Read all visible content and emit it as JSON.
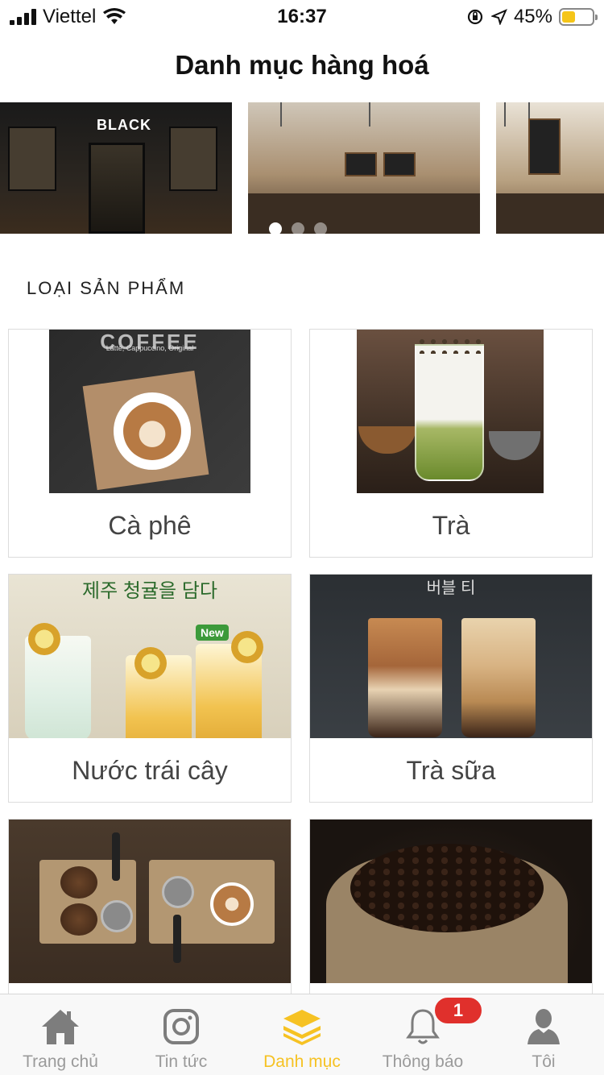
{
  "status_bar": {
    "carrier": "Viettel",
    "time": "16:37",
    "battery": "45%",
    "battery_level": 0.45
  },
  "header": {
    "title": "Danh mục hàng hoá"
  },
  "carousel": {
    "active_index": 0,
    "dot_count": 3,
    "slides": [
      {
        "icon": "black-coffee-shop-image",
        "sign": "BLACK"
      },
      {
        "icon": "coffee-counter-image"
      },
      {
        "icon": "coffee-bar-image"
      }
    ]
  },
  "section": {
    "title": "LOẠI SẢN PHẨM"
  },
  "categories": [
    {
      "label": "Cà phê",
      "icon": "coffee-poster-image",
      "poster_title": "COFFEE",
      "poster_sub": "Latte, Cappuccino, Original"
    },
    {
      "label": "Trà",
      "icon": "matcha-tea-image"
    },
    {
      "label": "Nước trái cây",
      "icon": "juice-image",
      "banner": "제주 청귤을 담다",
      "badge": "New"
    },
    {
      "label": "Trà sữa",
      "icon": "bubble-milk-tea-image",
      "banner": "버블 티"
    },
    {
      "label": "",
      "icon": "coffee-tools-image"
    },
    {
      "label": "",
      "icon": "coffee-beans-image"
    }
  ],
  "tab_bar": {
    "items": [
      {
        "label": "Trang chủ",
        "icon": "home-icon",
        "active": false
      },
      {
        "label": "Tin tức",
        "icon": "instagram-icon",
        "active": false
      },
      {
        "label": "Danh mục",
        "icon": "layers-icon",
        "active": true
      },
      {
        "label": "Thông báo",
        "icon": "bell-icon",
        "active": false,
        "badge": "1"
      },
      {
        "label": "Tôi",
        "icon": "user-icon",
        "active": false
      }
    ]
  },
  "colors": {
    "accent": "#f6c223",
    "badge": "#e0302c",
    "inactive": "#9a9a9a"
  }
}
